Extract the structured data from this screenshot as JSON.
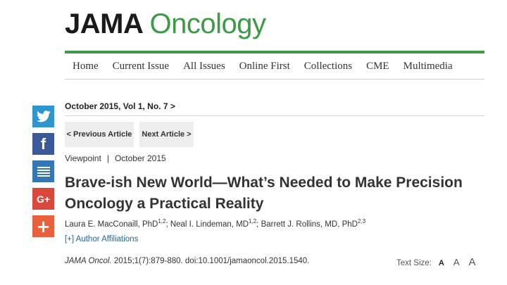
{
  "brand": {
    "part1": "JAMA",
    "part2": "Oncology",
    "accent_color": "#3d9a46"
  },
  "nav": {
    "items": [
      "Home",
      "Current Issue",
      "All Issues",
      "Online First",
      "Collections",
      "CME",
      "Multimedia"
    ]
  },
  "social": {
    "icons": [
      "twitter-icon",
      "facebook-icon",
      "share-icon",
      "google-plus-icon",
      "add-icon"
    ],
    "google_plus_label": "G+",
    "facebook_label": "f",
    "add_label": "+"
  },
  "issue": {
    "label": "October 2015, Vol 1, No. 7 >"
  },
  "pager": {
    "prev": "< Previous Article",
    "next": "Next Article >"
  },
  "article": {
    "type": "Viewpoint",
    "separator": "|",
    "date": "October 2015",
    "title": "Brave-ish New World—What’s Needed to Make Precision Oncology a Practical Reality",
    "authors": [
      {
        "name": "Laura E. MacConaill, PhD",
        "sup": "1,2",
        "sep": "; "
      },
      {
        "name": "Neal I. Lindeman, MD",
        "sup": "1,2",
        "sep": "; "
      },
      {
        "name": "Barrett J. Rollins, MD, PhD",
        "sup": "2,3",
        "sep": ""
      }
    ],
    "affiliations_link": "[+] Author Affiliations",
    "citation_journal": "JAMA Oncol.",
    "citation_rest": " 2015;1(7):879-880. doi:10.1001/jamaoncol.2015.1540."
  },
  "text_size": {
    "label": "Text Size:",
    "options": [
      "A",
      "A",
      "A"
    ]
  }
}
